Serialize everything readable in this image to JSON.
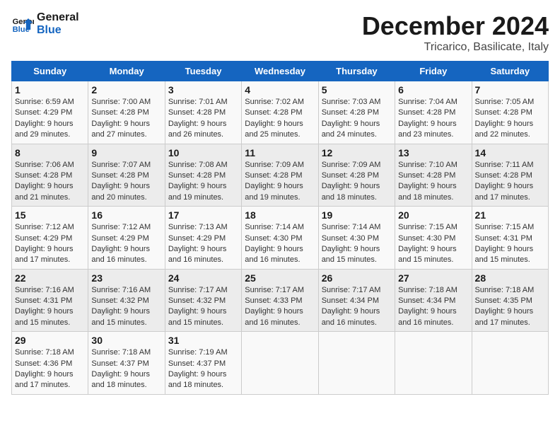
{
  "logo": {
    "line1": "General",
    "line2": "Blue"
  },
  "title": "December 2024",
  "subtitle": "Tricarico, Basilicate, Italy",
  "days_header": [
    "Sunday",
    "Monday",
    "Tuesday",
    "Wednesday",
    "Thursday",
    "Friday",
    "Saturday"
  ],
  "weeks": [
    [
      {
        "day": "1",
        "sunrise": "6:59 AM",
        "sunset": "4:29 PM",
        "daylight": "9 hours and 29 minutes."
      },
      {
        "day": "2",
        "sunrise": "7:00 AM",
        "sunset": "4:28 PM",
        "daylight": "9 hours and 27 minutes."
      },
      {
        "day": "3",
        "sunrise": "7:01 AM",
        "sunset": "4:28 PM",
        "daylight": "9 hours and 26 minutes."
      },
      {
        "day": "4",
        "sunrise": "7:02 AM",
        "sunset": "4:28 PM",
        "daylight": "9 hours and 25 minutes."
      },
      {
        "day": "5",
        "sunrise": "7:03 AM",
        "sunset": "4:28 PM",
        "daylight": "9 hours and 24 minutes."
      },
      {
        "day": "6",
        "sunrise": "7:04 AM",
        "sunset": "4:28 PM",
        "daylight": "9 hours and 23 minutes."
      },
      {
        "day": "7",
        "sunrise": "7:05 AM",
        "sunset": "4:28 PM",
        "daylight": "9 hours and 22 minutes."
      }
    ],
    [
      {
        "day": "8",
        "sunrise": "7:06 AM",
        "sunset": "4:28 PM",
        "daylight": "9 hours and 21 minutes."
      },
      {
        "day": "9",
        "sunrise": "7:07 AM",
        "sunset": "4:28 PM",
        "daylight": "9 hours and 20 minutes."
      },
      {
        "day": "10",
        "sunrise": "7:08 AM",
        "sunset": "4:28 PM",
        "daylight": "9 hours and 19 minutes."
      },
      {
        "day": "11",
        "sunrise": "7:09 AM",
        "sunset": "4:28 PM",
        "daylight": "9 hours and 19 minutes."
      },
      {
        "day": "12",
        "sunrise": "7:09 AM",
        "sunset": "4:28 PM",
        "daylight": "9 hours and 18 minutes."
      },
      {
        "day": "13",
        "sunrise": "7:10 AM",
        "sunset": "4:28 PM",
        "daylight": "9 hours and 18 minutes."
      },
      {
        "day": "14",
        "sunrise": "7:11 AM",
        "sunset": "4:28 PM",
        "daylight": "9 hours and 17 minutes."
      }
    ],
    [
      {
        "day": "15",
        "sunrise": "7:12 AM",
        "sunset": "4:29 PM",
        "daylight": "9 hours and 17 minutes."
      },
      {
        "day": "16",
        "sunrise": "7:12 AM",
        "sunset": "4:29 PM",
        "daylight": "9 hours and 16 minutes."
      },
      {
        "day": "17",
        "sunrise": "7:13 AM",
        "sunset": "4:29 PM",
        "daylight": "9 hours and 16 minutes."
      },
      {
        "day": "18",
        "sunrise": "7:14 AM",
        "sunset": "4:30 PM",
        "daylight": "9 hours and 16 minutes."
      },
      {
        "day": "19",
        "sunrise": "7:14 AM",
        "sunset": "4:30 PM",
        "daylight": "9 hours and 15 minutes."
      },
      {
        "day": "20",
        "sunrise": "7:15 AM",
        "sunset": "4:30 PM",
        "daylight": "9 hours and 15 minutes."
      },
      {
        "day": "21",
        "sunrise": "7:15 AM",
        "sunset": "4:31 PM",
        "daylight": "9 hours and 15 minutes."
      }
    ],
    [
      {
        "day": "22",
        "sunrise": "7:16 AM",
        "sunset": "4:31 PM",
        "daylight": "9 hours and 15 minutes."
      },
      {
        "day": "23",
        "sunrise": "7:16 AM",
        "sunset": "4:32 PM",
        "daylight": "9 hours and 15 minutes."
      },
      {
        "day": "24",
        "sunrise": "7:17 AM",
        "sunset": "4:32 PM",
        "daylight": "9 hours and 15 minutes."
      },
      {
        "day": "25",
        "sunrise": "7:17 AM",
        "sunset": "4:33 PM",
        "daylight": "9 hours and 16 minutes."
      },
      {
        "day": "26",
        "sunrise": "7:17 AM",
        "sunset": "4:34 PM",
        "daylight": "9 hours and 16 minutes."
      },
      {
        "day": "27",
        "sunrise": "7:18 AM",
        "sunset": "4:34 PM",
        "daylight": "9 hours and 16 minutes."
      },
      {
        "day": "28",
        "sunrise": "7:18 AM",
        "sunset": "4:35 PM",
        "daylight": "9 hours and 17 minutes."
      }
    ],
    [
      {
        "day": "29",
        "sunrise": "7:18 AM",
        "sunset": "4:36 PM",
        "daylight": "9 hours and 17 minutes."
      },
      {
        "day": "30",
        "sunrise": "7:18 AM",
        "sunset": "4:37 PM",
        "daylight": "9 hours and 18 minutes."
      },
      {
        "day": "31",
        "sunrise": "7:19 AM",
        "sunset": "4:37 PM",
        "daylight": "9 hours and 18 minutes."
      },
      null,
      null,
      null,
      null
    ]
  ]
}
